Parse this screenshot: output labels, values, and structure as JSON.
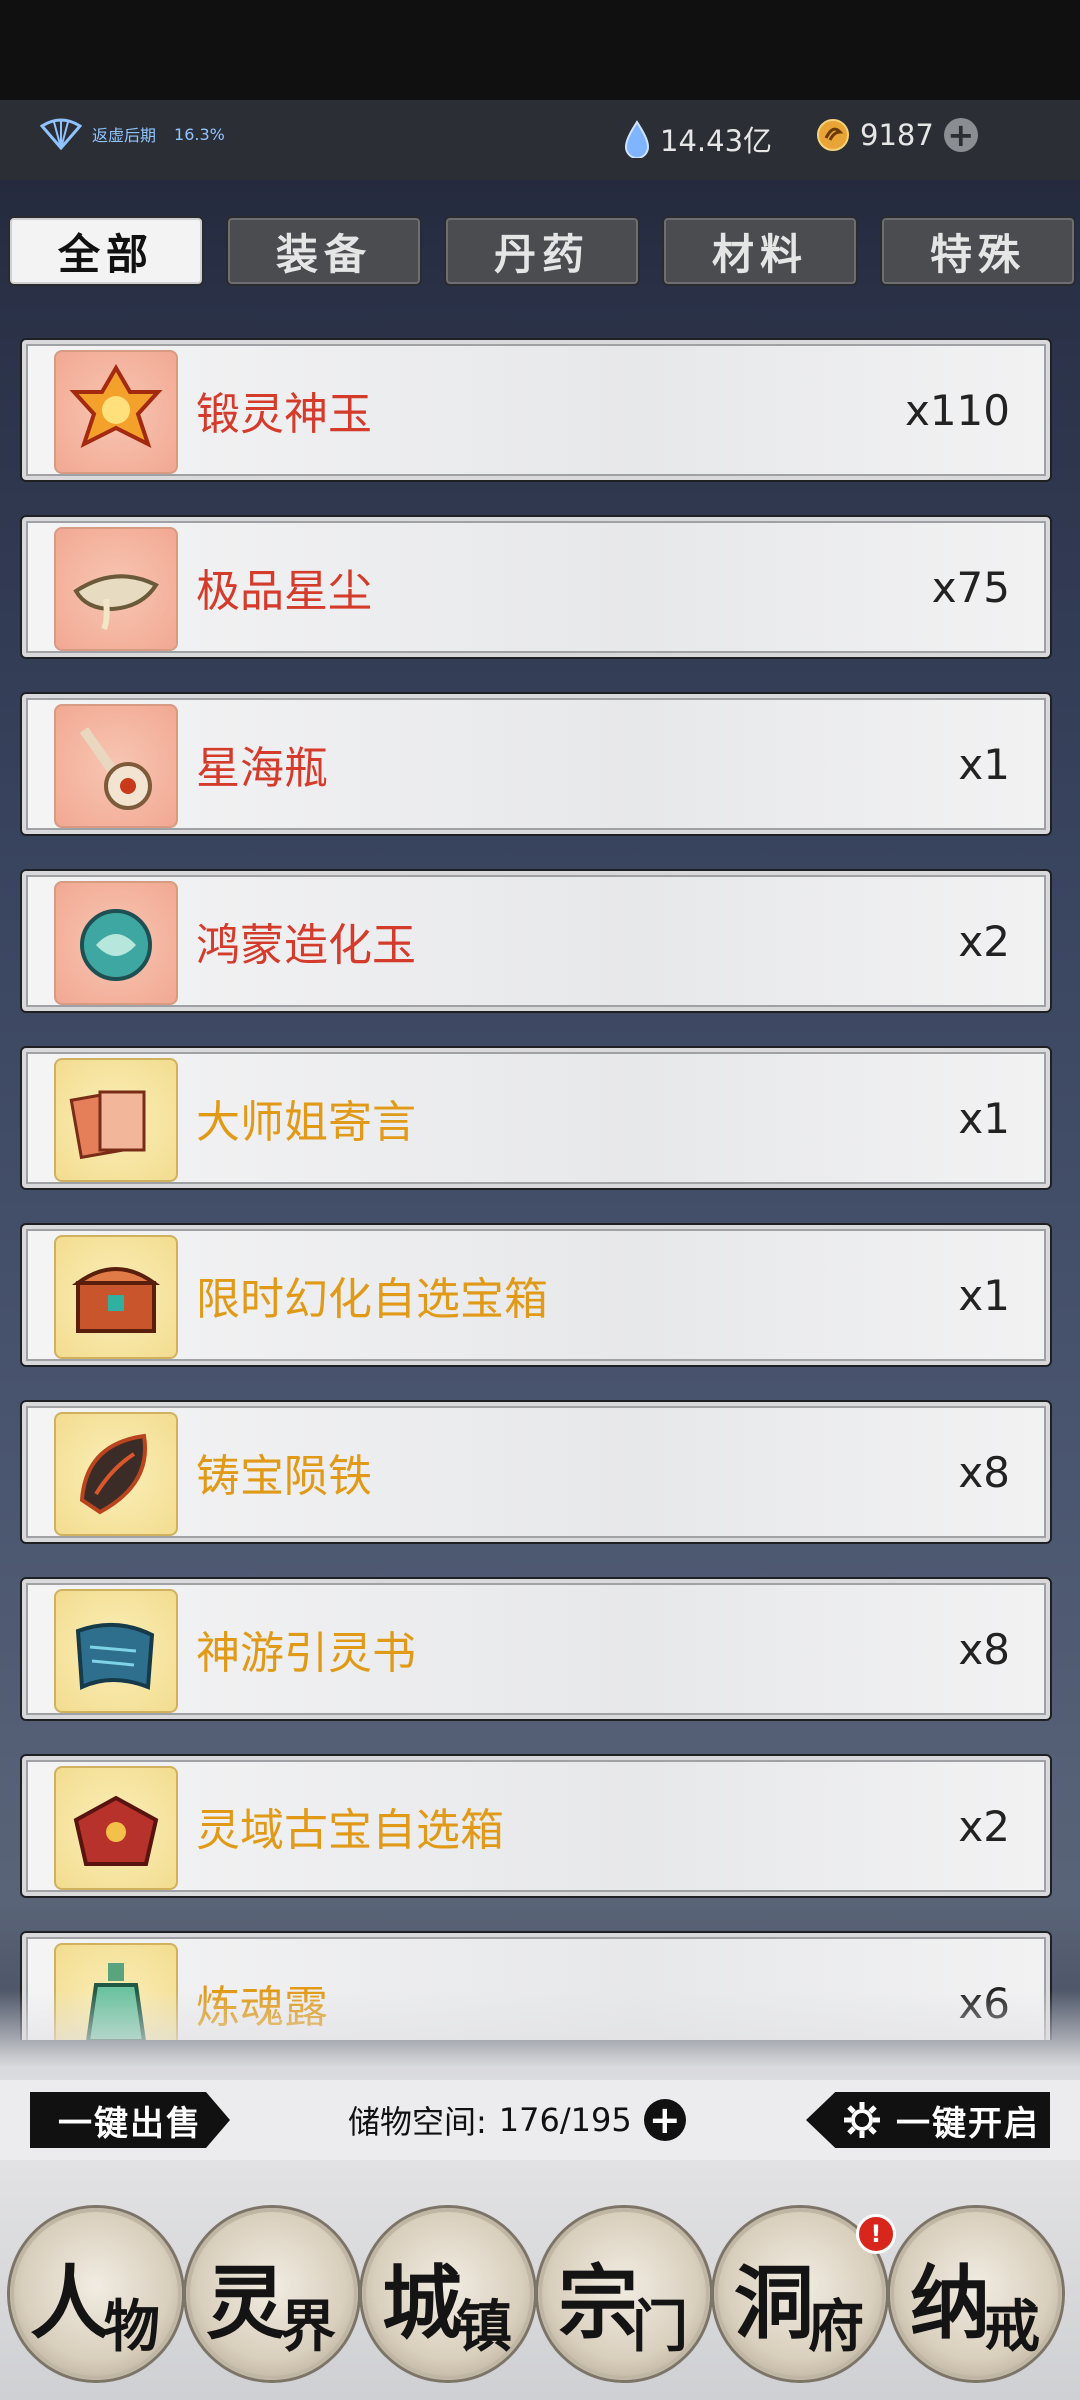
{
  "status": {
    "stage_label": "返虚后期",
    "stage_percent": "16.3%",
    "spirit_stones": "14.43亿",
    "gold": "9187"
  },
  "tabs": [
    {
      "label": "全部",
      "active": true
    },
    {
      "label": "装备",
      "active": false
    },
    {
      "label": "丹药",
      "active": false
    },
    {
      "label": "材料",
      "active": false
    },
    {
      "label": "特殊",
      "active": false
    }
  ],
  "items": [
    {
      "name": "锻灵神玉",
      "count": "x110",
      "rarity": "red",
      "icon": "gem-flower-icon"
    },
    {
      "name": "极品星尘",
      "count": "x75",
      "rarity": "red",
      "icon": "stardust-icon"
    },
    {
      "name": "星海瓶",
      "count": "x1",
      "rarity": "red",
      "icon": "gourd-icon"
    },
    {
      "name": "鸿蒙造化玉",
      "count": "x2",
      "rarity": "red",
      "icon": "jade-icon"
    },
    {
      "name": "大师姐寄言",
      "count": "x1",
      "rarity": "gold",
      "icon": "letters-icon"
    },
    {
      "name": "限时幻化自选宝箱",
      "count": "x1",
      "rarity": "gold",
      "icon": "chest-icon"
    },
    {
      "name": "铸宝陨铁",
      "count": "x8",
      "rarity": "gold",
      "icon": "meteor-iron-icon"
    },
    {
      "name": "神游引灵书",
      "count": "x8",
      "rarity": "gold",
      "icon": "scroll-icon"
    },
    {
      "name": "灵域古宝自选箱",
      "count": "x2",
      "rarity": "gold",
      "icon": "treasure-box-icon"
    },
    {
      "name": "炼魂露",
      "count": "x6",
      "rarity": "gold",
      "icon": "potion-icon"
    }
  ],
  "bottom": {
    "sell_all": "一键出售",
    "storage_label": "储物空间:",
    "storage_value": "176/195",
    "open_all": "一键开启"
  },
  "nav": [
    {
      "big": "人",
      "small": "物"
    },
    {
      "big": "灵",
      "small": "界"
    },
    {
      "big": "城",
      "small": "镇"
    },
    {
      "big": "宗",
      "small": "门"
    },
    {
      "big": "洞",
      "small": "府"
    },
    {
      "big": "纳",
      "small": "戒"
    }
  ],
  "nav_badge": "!",
  "colors": {
    "red_rarity": "#d53b2b",
    "gold_rarity": "#e19a17",
    "stage_blue": "#8fc3ff"
  }
}
